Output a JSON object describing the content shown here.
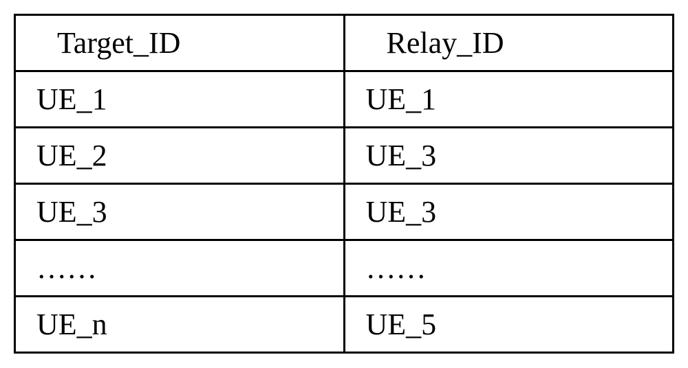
{
  "chart_data": {
    "type": "table",
    "columns": [
      "Target_ID",
      "Relay_ID"
    ],
    "rows": [
      [
        "UE_1",
        "UE_1"
      ],
      [
        "UE_2",
        "UE_3"
      ],
      [
        "UE_3",
        "UE_3"
      ],
      [
        "……",
        "……"
      ],
      [
        "UE_n",
        "UE_5"
      ]
    ]
  }
}
